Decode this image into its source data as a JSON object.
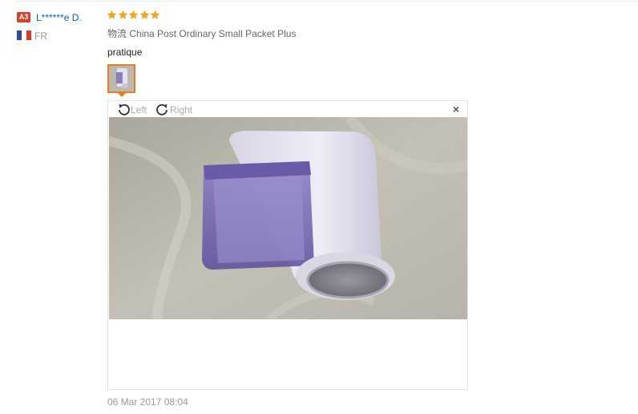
{
  "review": {
    "badge": "A3",
    "username": "L******e D.",
    "country": "FR",
    "rating_stars": 5,
    "logistics_label": "物流",
    "logistics_value": "China Post Ordinary Small Packet Plus",
    "text": "pratique",
    "date": "06 Mar 2017 08:04"
  },
  "viewer": {
    "rotate_left_label": "Left",
    "rotate_right_label": "Right",
    "close_label": "×"
  },
  "colors": {
    "badge": "#d93e26",
    "username": "#0066cc",
    "star": "#f7a21b",
    "thumb_border": "#e67e22"
  },
  "icons": [
    "star-icon",
    "rotate-left-icon",
    "rotate-right-icon",
    "close-icon",
    "france-flag-icon"
  ]
}
